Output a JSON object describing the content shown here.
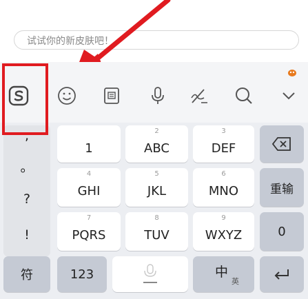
{
  "search": {
    "placeholder": "试试你的新皮肤吧！"
  },
  "toolbar": {
    "icons": [
      "sogou-logo-icon",
      "emoji-icon",
      "clipboard-icon",
      "microphone-icon",
      "handwriting-icon",
      "search-icon",
      "collapse-chevron-icon",
      "skin-icon"
    ]
  },
  "left_symbols": [
    ",",
    "。",
    "?",
    "!"
  ],
  "keys": {
    "row1": [
      {
        "num": "",
        "label": "1"
      },
      {
        "num": "2",
        "label": "ABC"
      },
      {
        "num": "3",
        "label": "DEF"
      }
    ],
    "row2": [
      {
        "num": "4",
        "label": "GHI"
      },
      {
        "num": "5",
        "label": "JKL"
      },
      {
        "num": "6",
        "label": "MNO"
      }
    ],
    "row3": [
      {
        "num": "7",
        "label": "PQRS"
      },
      {
        "num": "8",
        "label": "TUV"
      },
      {
        "num": "9",
        "label": "WXYZ"
      }
    ],
    "right": [
      "重输",
      "0"
    ],
    "bottom": {
      "symbols": "符",
      "numbers": "123",
      "lang_main": "中",
      "lang_sub": "英"
    }
  },
  "colors": {
    "highlight": "#e01b20",
    "keyboard_bg": "#eceef2",
    "gray_key": "#c5cad4"
  }
}
